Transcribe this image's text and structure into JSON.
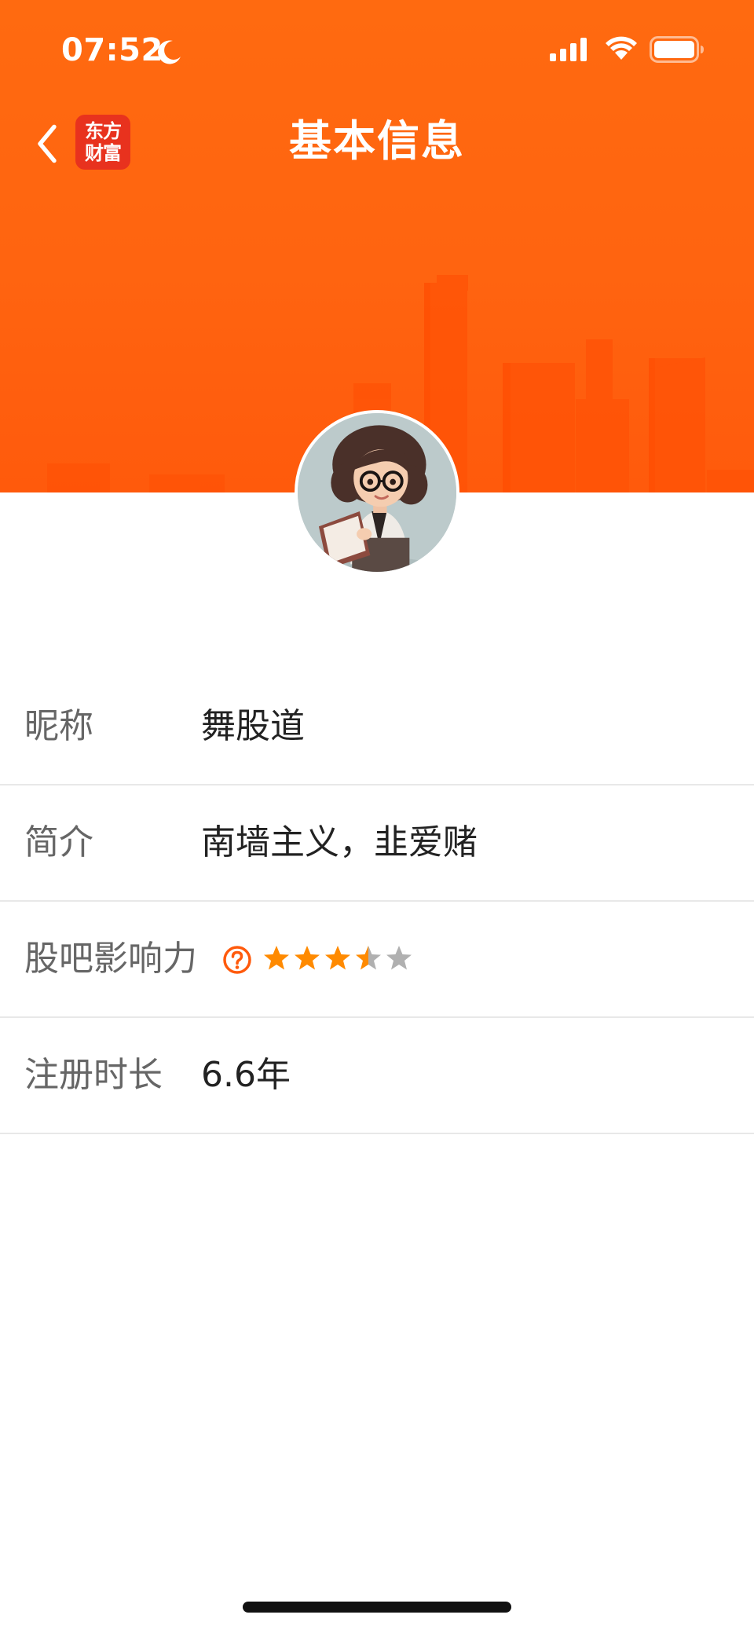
{
  "status_bar": {
    "time": "07:52"
  },
  "nav": {
    "title": "基本信息",
    "logo_line1": "东方",
    "logo_line2": "财富"
  },
  "colors": {
    "brand_orange": "#ff6410",
    "logo_red": "#e8321e",
    "star_active": "#ff8a00",
    "star_inactive": "#b0b0b0",
    "help_icon": "#ff5a0c"
  },
  "icons": {
    "back": "chevron-left-icon",
    "moon": "moon-icon",
    "signal": "signal-bars-icon",
    "wifi": "wifi-icon",
    "battery": "battery-icon",
    "help": "question-circle-icon",
    "star": "star-icon"
  },
  "profile": {
    "nickname_label": "昵称",
    "nickname": "舞股道",
    "bio_label": "简介",
    "bio": "南墙主义，韭爱赌",
    "influence_label": "股吧影响力",
    "influence_rating": 3.5,
    "influence_max": 5,
    "registration_label": "注册时长",
    "registration_duration": "6.6年"
  }
}
